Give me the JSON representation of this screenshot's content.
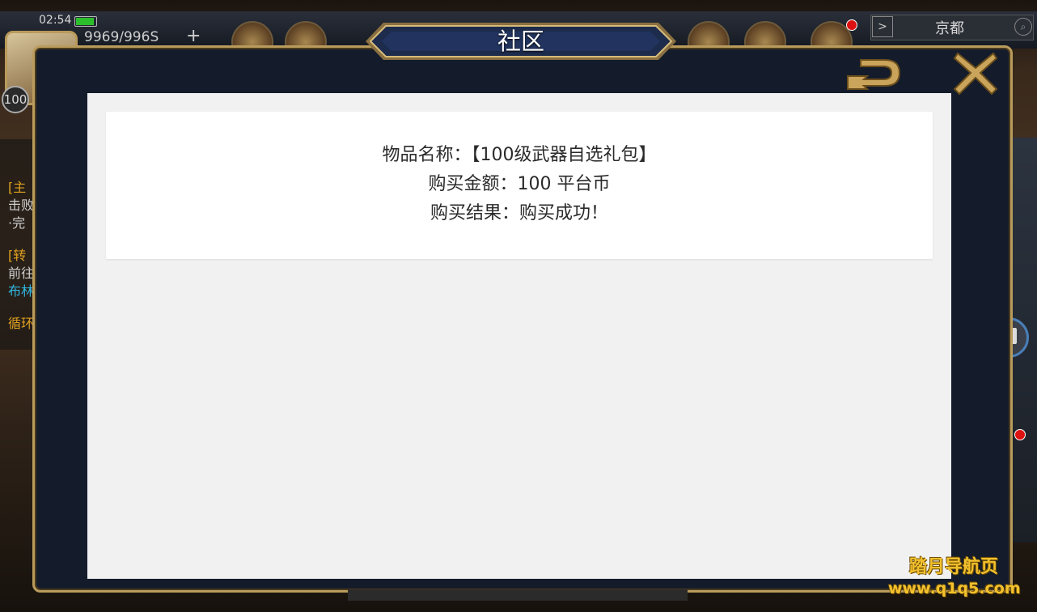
{
  "status_bar": {
    "time": "02:54",
    "energy": "9969/996S",
    "energy_plus": "+"
  },
  "player": {
    "level": "100"
  },
  "location": {
    "arrow": ">",
    "name": "京都",
    "search_icon": "search-icon"
  },
  "left_panel": {
    "lines": [
      "[主",
      "击败",
      "·完",
      "[转",
      "前往",
      "布林",
      "循环"
    ]
  },
  "modal": {
    "title": "社区",
    "back_icon": "back-arrow-icon",
    "close_icon": "close-icon"
  },
  "receipt": {
    "item_line": "物品名称：【100级武器自选礼包】",
    "amount_line": "购买金额：100 平台币",
    "result_line": "购买结果：购买成功！"
  },
  "watermark": {
    "line1": "踏月导航页",
    "line2": "www.q1q5.com"
  },
  "colors": {
    "modal_bg": "#141c2b",
    "frame_gold": "#b99b5c",
    "content_bg": "#f1f1f1",
    "card_bg": "#ffffff",
    "watermark": "#f2c12e"
  }
}
